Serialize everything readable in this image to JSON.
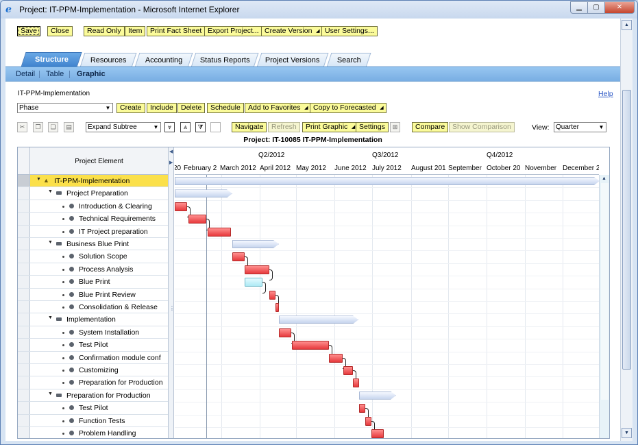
{
  "window": {
    "title": "Project: IT-PPM-Implementation - Microsoft Internet Explorer"
  },
  "toolbar": {
    "save": "Save",
    "close": "Close",
    "read_only": "Read Only",
    "item": "Item",
    "print_fact_sheet": "Print Fact Sheet",
    "export_project": "Export Project...",
    "create_version": "Create Version",
    "user_settings": "User Settings..."
  },
  "tabs": [
    "Structure",
    "Resources",
    "Accounting",
    "Status Reports",
    "Project Versions",
    "Search"
  ],
  "subnav": [
    "Detail",
    "Table",
    "Graphic"
  ],
  "breadcrumb": "IT-PPM-Implementation",
  "help": "Help",
  "actions": {
    "phase_value": "Phase",
    "create": "Create",
    "include": "Include",
    "delete": "Delete",
    "schedule": "Schedule",
    "add_to_favorites": "Add to Favorites",
    "copy_to_forecasted": "Copy to Forecasted"
  },
  "graphic_toolbar": {
    "expand_value": "Expand Subtree",
    "navigate": "Navigate",
    "refresh": "Refresh",
    "print_graphic": "Print Graphic",
    "settings": "Settings",
    "compare": "Compare",
    "show_comparison": "Show Comparison",
    "view_label": "View:",
    "view_value": "Quarter"
  },
  "chart_title": "Project: IT-10085 IT-PPM-Implementation",
  "gantt": {
    "left_header": "Project Element",
    "quarters": [
      "Q2/2012",
      "Q3/2012",
      "Q4/2012"
    ],
    "months": [
      "20",
      "February 2",
      "March 2012",
      "April 2012",
      "May 2012",
      "June 2012",
      "July 2012",
      "August 201",
      "September",
      "October 20",
      "November",
      "December 2"
    ],
    "rows": [
      {
        "label": "IT-PPM-Implementation",
        "level": 0,
        "kind": "project"
      },
      {
        "label": "Project Preparation",
        "level": 1,
        "kind": "phase"
      },
      {
        "label": "Introduction & Clearing",
        "level": 2,
        "kind": "task"
      },
      {
        "label": "Technical Requirements",
        "level": 2,
        "kind": "task"
      },
      {
        "label": "IT Project preparation",
        "level": 2,
        "kind": "task"
      },
      {
        "label": "Business Blue Print",
        "level": 1,
        "kind": "phase"
      },
      {
        "label": "Solution Scope",
        "level": 2,
        "kind": "task"
      },
      {
        "label": "Process Analysis",
        "level": 2,
        "kind": "task"
      },
      {
        "label": "Blue Print",
        "level": 2,
        "kind": "task"
      },
      {
        "label": "Blue Print Review",
        "level": 2,
        "kind": "task"
      },
      {
        "label": "Consolidation & Release",
        "level": 2,
        "kind": "task"
      },
      {
        "label": "Implementation",
        "level": 1,
        "kind": "phase"
      },
      {
        "label": "System Installation",
        "level": 2,
        "kind": "task"
      },
      {
        "label": "Test Pilot",
        "level": 2,
        "kind": "task"
      },
      {
        "label": "Confirmation module conf",
        "level": 2,
        "kind": "task"
      },
      {
        "label": "Customizing",
        "level": 2,
        "kind": "task"
      },
      {
        "label": "Preparation for Production",
        "level": 2,
        "kind": "task"
      },
      {
        "label": "Preparation for Production",
        "level": 1,
        "kind": "phase"
      },
      {
        "label": "Test Pilot",
        "level": 2,
        "kind": "task"
      },
      {
        "label": "Function Tests",
        "level": 2,
        "kind": "task"
      },
      {
        "label": "Problem Handling",
        "level": 2,
        "kind": "task"
      }
    ]
  }
}
